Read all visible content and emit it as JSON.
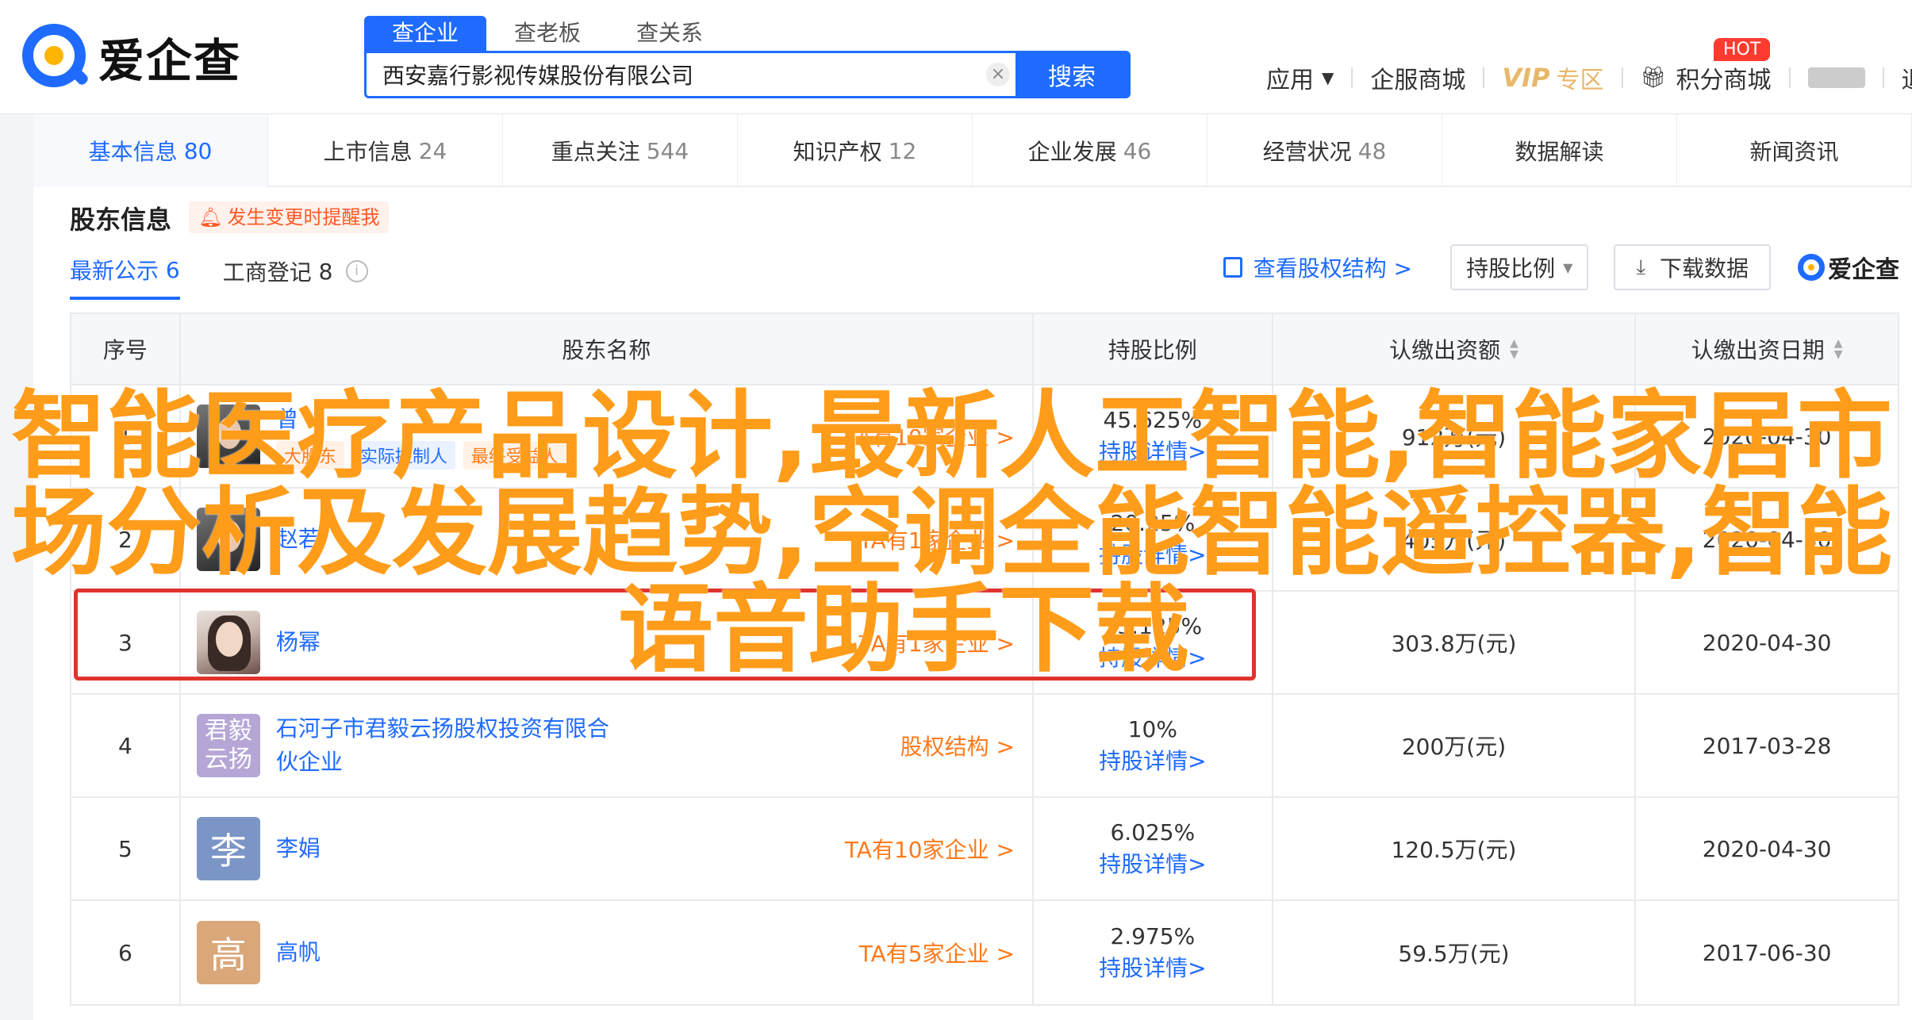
{
  "header": {
    "logo_text": "爱企查",
    "search_tabs": [
      "查企业",
      "查老板",
      "查关系"
    ],
    "search_value": "西安嘉行影视传媒股份有限公司",
    "search_button": "搜索",
    "nav": {
      "apps": "应用",
      "enterprise_mall": "企服商城",
      "vip": "VIP",
      "vip_zone": "专区",
      "points_mall": "积分商城",
      "hot_badge": "HOT",
      "user": "",
      "logout": "退出"
    }
  },
  "main_tabs": [
    {
      "label": "基本信息",
      "count": "80"
    },
    {
      "label": "上市信息",
      "count": "24"
    },
    {
      "label": "重点关注",
      "count": "544"
    },
    {
      "label": "知识产权",
      "count": "12"
    },
    {
      "label": "企业发展",
      "count": "46"
    },
    {
      "label": "经营状况",
      "count": "48"
    },
    {
      "label": "数据解读",
      "count": ""
    },
    {
      "label": "新闻资讯",
      "count": ""
    }
  ],
  "section": {
    "title": "股东信息",
    "remind": "发生变更时提醒我",
    "sub_tabs": [
      {
        "label": "最新公示",
        "count": "6"
      },
      {
        "label": "工商登记",
        "count": "8"
      }
    ],
    "equity_link": "查看股权结构 >",
    "select_value": "持股比例",
    "download": "下载数据",
    "mini_logo": "爱企查"
  },
  "table": {
    "headers": [
      "序号",
      "股东名称",
      "持股比例",
      "认缴出资额",
      "认缴出资日期"
    ],
    "rows": [
      {
        "no": "1",
        "avatar": "",
        "name": "曾",
        "tags": [
          "大股东",
          "实际控制人",
          "最终受益人"
        ],
        "link": "TA有10家企业 >",
        "pct": "45.625%",
        "detail": "持股详情>",
        "amount": "912万(元)",
        "date": "2020-04-30"
      },
      {
        "no": "2",
        "avatar": "",
        "name": "赵若",
        "tags": [],
        "link": "TA有1家企业 >",
        "pct": "20.25%",
        "detail": "持股详情>",
        "amount": "405万(元)",
        "date": "2020-04-30"
      },
      {
        "no": "3",
        "avatar": "",
        "name": "杨幂",
        "tags": [],
        "link": "TA有1家企业 >",
        "pct": "15.125%",
        "detail": "持股详情>",
        "amount": "303.8万(元)",
        "date": "2020-04-30"
      },
      {
        "no": "4",
        "avatar": "君毅云扬",
        "name": "石河子市君毅云扬股权投资有限合伙企业",
        "tags": [],
        "link": "股权结构 >",
        "pct": "10%",
        "detail": "持股详情>",
        "amount": "200万(元)",
        "date": "2017-03-28"
      },
      {
        "no": "5",
        "avatar": "李",
        "name": "李娟",
        "tags": [],
        "link": "TA有10家企业 >",
        "pct": "6.025%",
        "detail": "持股详情>",
        "amount": "120.5万(元)",
        "date": "2020-04-30"
      },
      {
        "no": "6",
        "avatar": "高",
        "name": "高帆",
        "tags": [],
        "link": "TA有5家企业 >",
        "pct": "2.975%",
        "detail": "持股详情>",
        "amount": "59.5万(元)",
        "date": "2017-06-30"
      }
    ]
  },
  "overlay": {
    "line1": "智能医疗产品设计,最新人工智能,智能家居市",
    "line2": "场分析及发展趋势,空调全能智能遥控器,智能",
    "line3": "语音助手下载"
  },
  "colors": {
    "brand_blue": "#1f6bff",
    "link_orange": "#ff7a1a",
    "overlay_orange": "#ff9c1a",
    "highlight_red": "#e0332e"
  }
}
